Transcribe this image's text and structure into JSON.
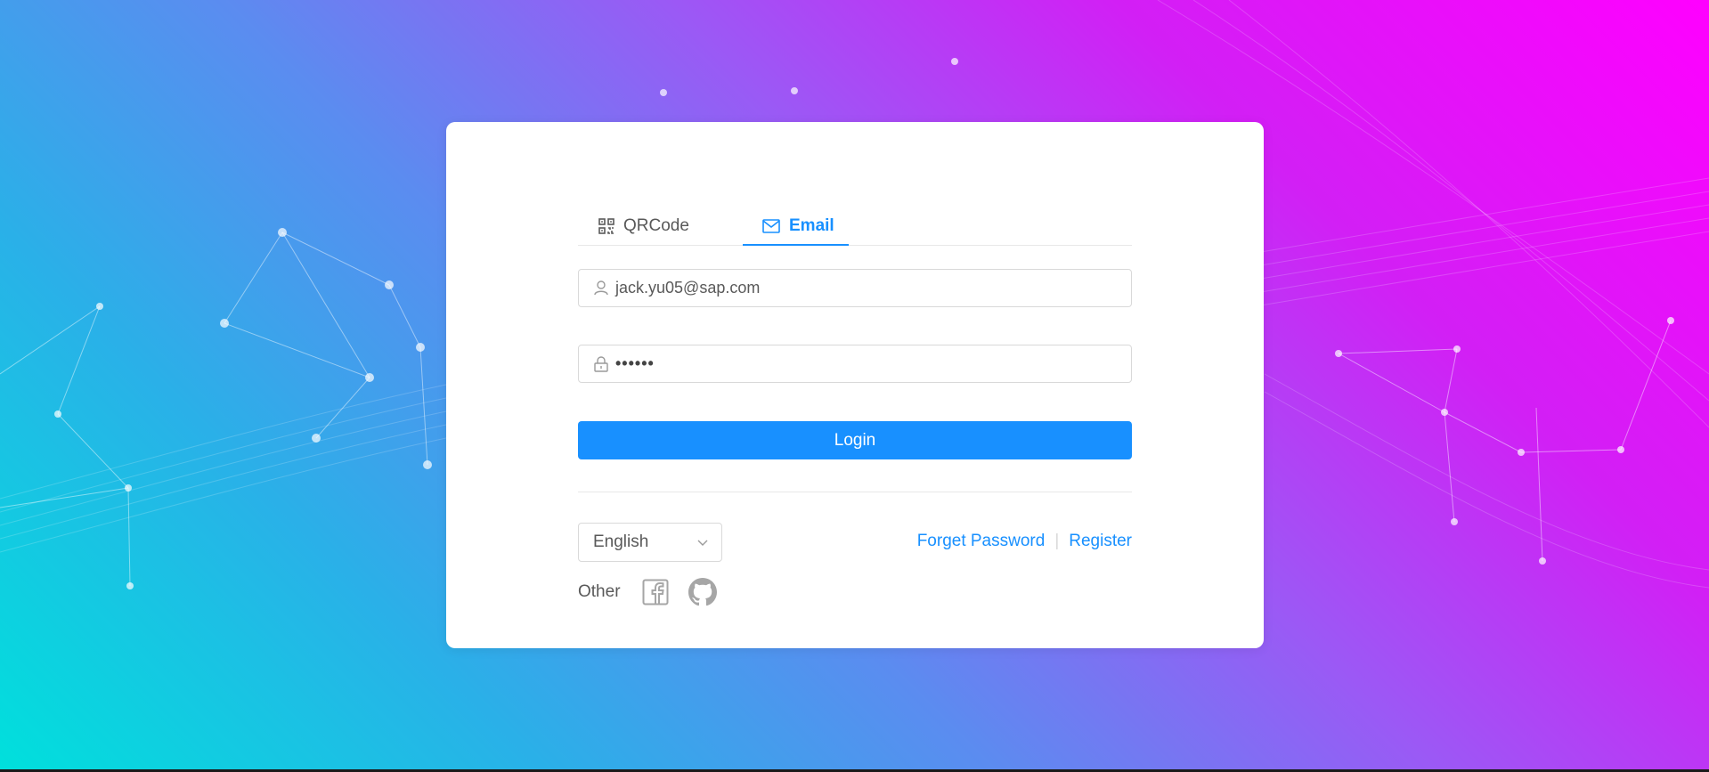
{
  "tabs": [
    {
      "label": "QRCode",
      "icon": "qrcode-icon",
      "active": false
    },
    {
      "label": "Email",
      "icon": "mail-icon",
      "active": true
    }
  ],
  "email_input": {
    "value": "jack.yu05@sap.com",
    "icon": "user-icon"
  },
  "password_input": {
    "value": "••••••",
    "icon": "lock-icon"
  },
  "login_button": {
    "label": "Login"
  },
  "language_select": {
    "value": "English",
    "icon": "chevron-down-icon"
  },
  "links": {
    "forget_password": "Forget Password",
    "separator": "|",
    "register": "Register"
  },
  "other_login": {
    "label": "Other",
    "icons": [
      "facebook-icon",
      "github-icon"
    ]
  },
  "colors": {
    "accent": "#1890ff",
    "gradient_start": "#00e0dc",
    "gradient_end": "#ff00ff"
  }
}
